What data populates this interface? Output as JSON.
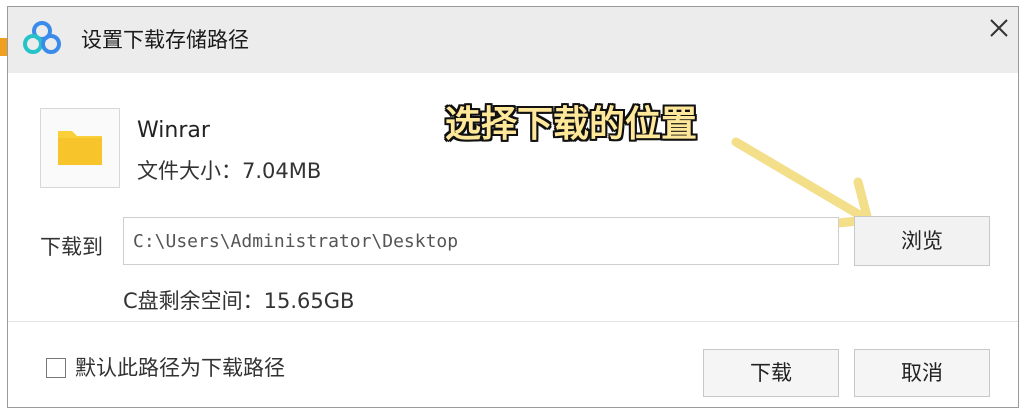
{
  "dialog": {
    "title": "设置下载存储路径",
    "close_icon": "close-icon",
    "app_icon": "baidu-netdisk-logo"
  },
  "file": {
    "icon": "folder-icon",
    "name": "Winrar",
    "size_text": "文件大小：7.04MB"
  },
  "annotation": {
    "text": "选择下载的位置",
    "color": "#ffe89a",
    "arrow_color": "#f3de8a"
  },
  "destination": {
    "label": "下载到",
    "path_value": "C:\\Users\\Administrator\\Desktop",
    "browse_label": "浏览",
    "space_text": "C盘剩余空间：15.65GB"
  },
  "footer": {
    "default_checkbox_label": "默认此路径为下载路径",
    "default_checked": false,
    "download_label": "下载",
    "cancel_label": "取消"
  },
  "colors": {
    "folder": "#f9cf3a",
    "titlebar": "#ececec",
    "logo_blue": "#3b8beb",
    "logo_teal": "#25c2c8"
  }
}
